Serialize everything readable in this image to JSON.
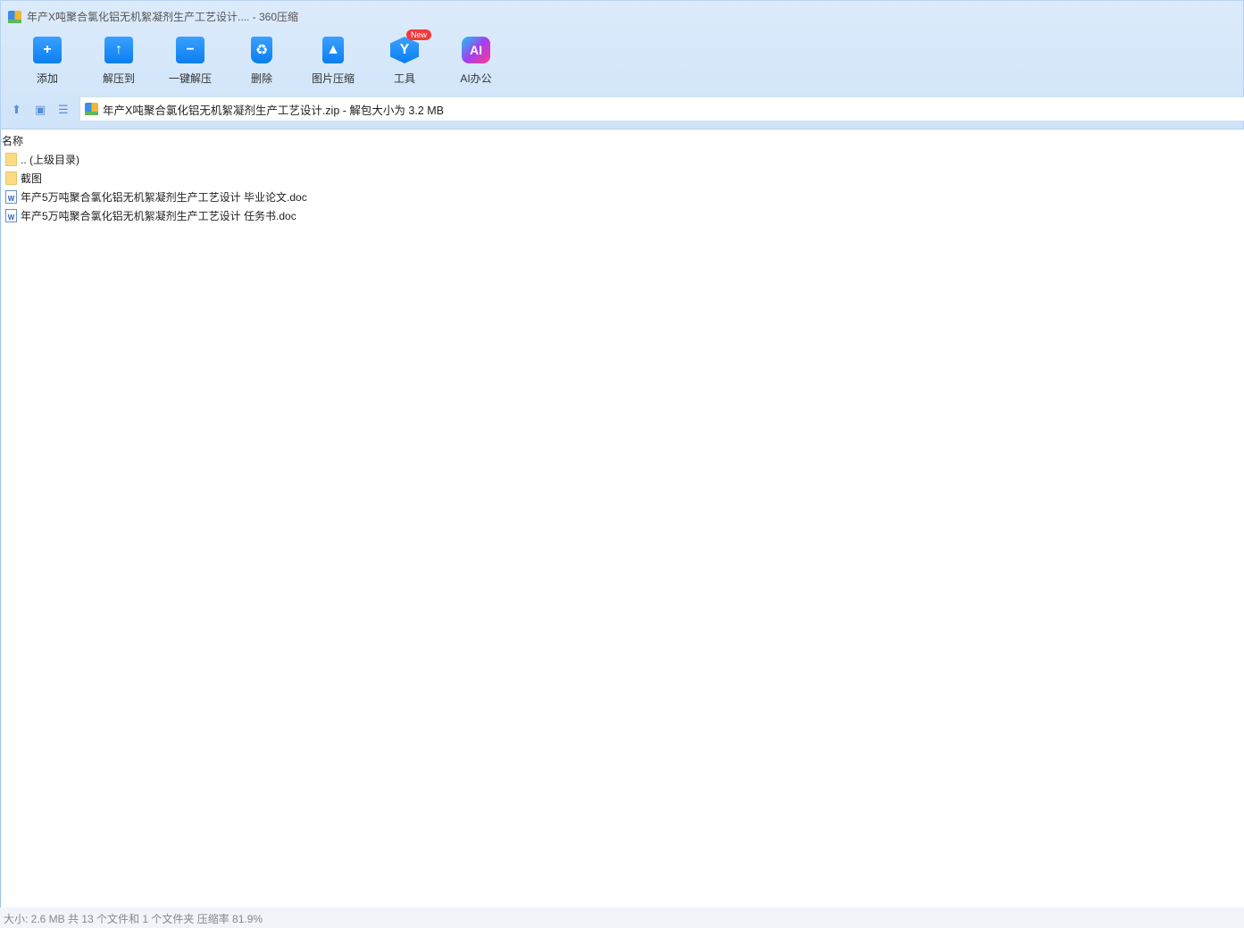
{
  "window": {
    "title": "年产X吨聚合氯化铝无机絮凝剂生产工艺设计.... - 360压缩"
  },
  "toolbar": [
    {
      "label": "添加",
      "icon": "+"
    },
    {
      "label": "解压到",
      "icon": "↑"
    },
    {
      "label": "一键解压",
      "icon": "−"
    },
    {
      "label": "删除",
      "icon": "♻"
    },
    {
      "label": "图片压缩",
      "icon": "▲"
    },
    {
      "label": "工具",
      "icon": "Y",
      "badge": "New"
    },
    {
      "label": "AI办公",
      "icon": "AI"
    }
  ],
  "address": {
    "text": "年产X吨聚合氯化铝无机絮凝剂生产工艺设计.zip - 解包大小为 3.2 MB"
  },
  "list": {
    "column": "名称",
    "items": [
      {
        "name": ".. (上级目录)",
        "type": "folder"
      },
      {
        "name": "截图",
        "type": "folder"
      },
      {
        "name": "年产5万吨聚合氯化铝无机絮凝剂生产工艺设计 毕业论文.doc",
        "type": "doc"
      },
      {
        "name": "年产5万吨聚合氯化铝无机絮凝剂生产工艺设计 任务书.doc",
        "type": "doc"
      }
    ]
  },
  "status": "大小: 2.6 MB 共 13 个文件和 1 个文件夹 压缩率 81.9%"
}
